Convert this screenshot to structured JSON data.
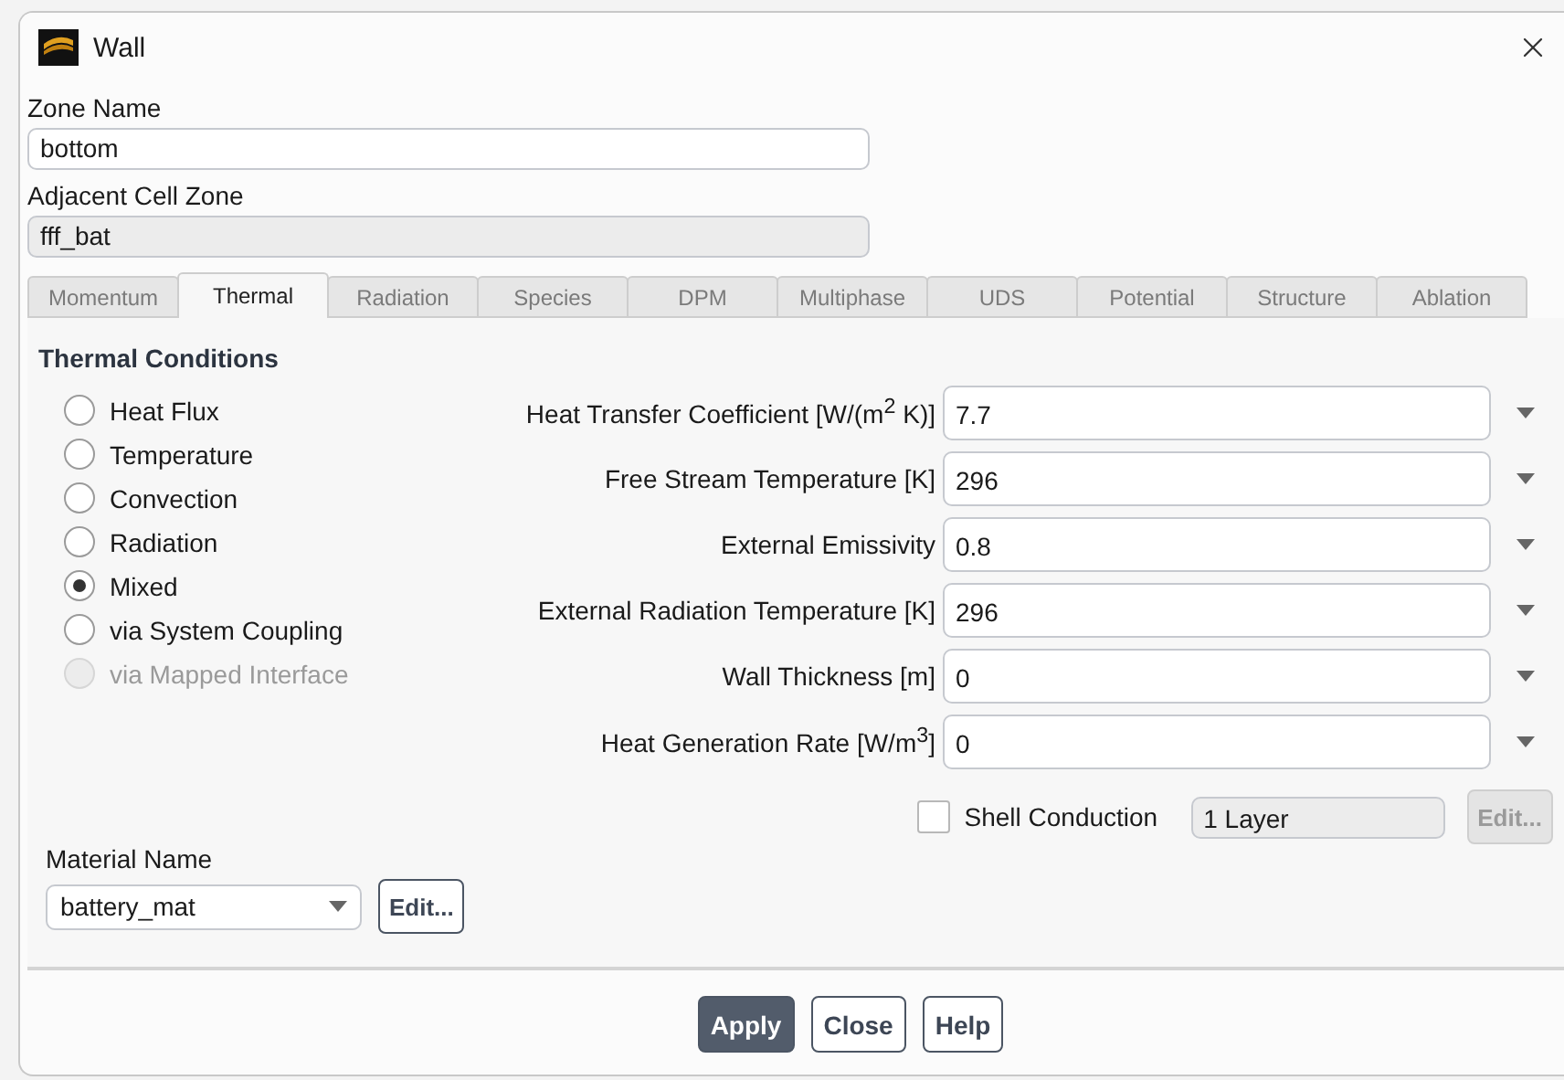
{
  "window": {
    "title": "Wall"
  },
  "zone_name": {
    "label": "Zone Name",
    "value": "bottom"
  },
  "adjacent_cell_zone": {
    "label": "Adjacent Cell Zone",
    "value": "fff_bat"
  },
  "tabs": [
    {
      "label": "Momentum",
      "selected": false
    },
    {
      "label": "Thermal",
      "selected": true
    },
    {
      "label": "Radiation",
      "selected": false
    },
    {
      "label": "Species",
      "selected": false
    },
    {
      "label": "DPM",
      "selected": false
    },
    {
      "label": "Multiphase",
      "selected": false
    },
    {
      "label": "UDS",
      "selected": false
    },
    {
      "label": "Potential",
      "selected": false
    },
    {
      "label": "Structure",
      "selected": false
    },
    {
      "label": "Ablation",
      "selected": false
    }
  ],
  "thermal_conditions": {
    "title": "Thermal Conditions",
    "options": [
      {
        "label": "Heat Flux",
        "selected": false,
        "disabled": false
      },
      {
        "label": "Temperature",
        "selected": false,
        "disabled": false
      },
      {
        "label": "Convection",
        "selected": false,
        "disabled": false
      },
      {
        "label": "Radiation",
        "selected": false,
        "disabled": false
      },
      {
        "label": "Mixed",
        "selected": true,
        "disabled": false
      },
      {
        "label": "via System Coupling",
        "selected": false,
        "disabled": false
      },
      {
        "label": "via Mapped Interface",
        "selected": false,
        "disabled": true
      }
    ]
  },
  "parameters": [
    {
      "label": "Heat Transfer Coefficient [W/(m$^{2}$ K)]",
      "value": "7.7"
    },
    {
      "label": "Free Stream Temperature [K]",
      "value": "296"
    },
    {
      "label": "External Emissivity",
      "value": "0.8"
    },
    {
      "label": "External Radiation Temperature [K]",
      "value": "296"
    },
    {
      "label": "Wall Thickness [m]",
      "value": "0"
    },
    {
      "label": "Heat Generation Rate [W/m$^{3}$]",
      "value": "0"
    }
  ],
  "shell_conduction": {
    "label": "Shell Conduction",
    "checked": false,
    "layers": "1 Layer",
    "edit": {
      "label": "Edit...",
      "disabled": true
    }
  },
  "material": {
    "label": "Material Name",
    "value": "battery_mat",
    "edit": {
      "label": "Edit...",
      "disabled": false
    }
  },
  "buttons": [
    {
      "label": "Apply",
      "kind": "primary"
    },
    {
      "label": "Close",
      "kind": "secondary"
    },
    {
      "label": "Help",
      "kind": "secondary"
    }
  ]
}
